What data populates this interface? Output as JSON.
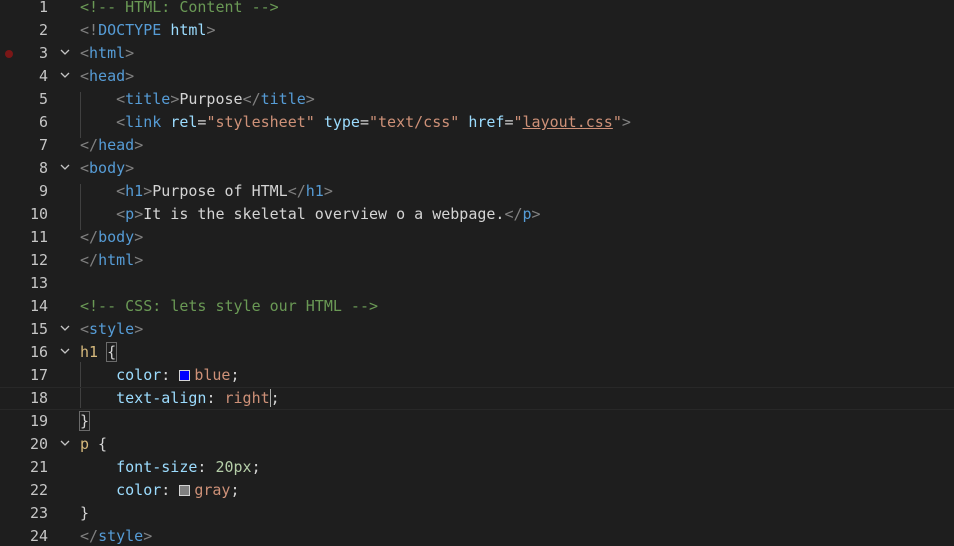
{
  "editor": {
    "breakpoint_line": 3,
    "colors": {
      "background": "#1e1e1e",
      "comment": "#6a9955",
      "tag": "#569cd6",
      "attribute": "#9cdcfe",
      "string": "#ce9178",
      "selector": "#d7ba7d",
      "number": "#b5cea8",
      "breakpoint": "#7a1717"
    },
    "swatches": {
      "blue": "#0000ff",
      "gray": "#808080"
    },
    "lines": [
      {
        "n": "1",
        "tokens": [
          [
            "c-comment",
            "<!-- HTML: Content -->"
          ]
        ]
      },
      {
        "n": "2",
        "tokens": [
          [
            "c-punct",
            "<!"
          ],
          [
            "c-tag",
            "DOCTYPE"
          ],
          [
            "c-text",
            " "
          ],
          [
            "c-attr",
            "html"
          ],
          [
            "c-punct",
            ">"
          ]
        ]
      },
      {
        "n": "3",
        "fold": true,
        "tokens": [
          [
            "c-punct",
            "<"
          ],
          [
            "c-tag",
            "html"
          ],
          [
            "c-punct",
            ">"
          ]
        ]
      },
      {
        "n": "4",
        "fold": true,
        "tokens": [
          [
            "c-punct",
            "<"
          ],
          [
            "c-tag",
            "head"
          ],
          [
            "c-punct",
            ">"
          ]
        ]
      },
      {
        "n": "5",
        "tokens": [
          [
            "c-text",
            "    "
          ],
          [
            "c-punct",
            "<"
          ],
          [
            "c-tag",
            "title"
          ],
          [
            "c-punct",
            ">"
          ],
          [
            "c-text",
            "Purpose"
          ],
          [
            "c-punct",
            "</"
          ],
          [
            "c-tag",
            "title"
          ],
          [
            "c-punct",
            ">"
          ]
        ]
      },
      {
        "n": "6",
        "tokens": [
          [
            "c-text",
            "    "
          ],
          [
            "c-punct",
            "<"
          ],
          [
            "c-tag",
            "link"
          ],
          [
            "c-text",
            " "
          ],
          [
            "c-attr",
            "rel"
          ],
          [
            "c-text",
            "="
          ],
          [
            "c-str",
            "\"stylesheet\""
          ],
          [
            "c-text",
            " "
          ],
          [
            "c-attr",
            "type"
          ],
          [
            "c-text",
            "="
          ],
          [
            "c-str",
            "\"text/css\""
          ],
          [
            "c-text",
            " "
          ],
          [
            "c-attr",
            "href"
          ],
          [
            "c-text",
            "="
          ],
          [
            "c-str",
            "\""
          ],
          [
            "c-str link-under",
            "layout.css"
          ],
          [
            "c-str",
            "\""
          ],
          [
            "c-punct",
            ">"
          ]
        ]
      },
      {
        "n": "7",
        "tokens": [
          [
            "c-punct",
            "</"
          ],
          [
            "c-tag",
            "head"
          ],
          [
            "c-punct",
            ">"
          ]
        ]
      },
      {
        "n": "8",
        "fold": true,
        "tokens": [
          [
            "c-punct",
            "<"
          ],
          [
            "c-tag",
            "body"
          ],
          [
            "c-punct",
            ">"
          ]
        ]
      },
      {
        "n": "9",
        "tokens": [
          [
            "c-text",
            "    "
          ],
          [
            "c-punct",
            "<"
          ],
          [
            "c-tag",
            "h1"
          ],
          [
            "c-punct",
            ">"
          ],
          [
            "c-text",
            "Purpose of HTML"
          ],
          [
            "c-punct",
            "</"
          ],
          [
            "c-tag",
            "h1"
          ],
          [
            "c-punct",
            ">"
          ]
        ]
      },
      {
        "n": "10",
        "tokens": [
          [
            "c-text",
            "    "
          ],
          [
            "c-punct",
            "<"
          ],
          [
            "c-tag",
            "p"
          ],
          [
            "c-punct",
            ">"
          ],
          [
            "c-text",
            "It is the skeletal overview o a webpage."
          ],
          [
            "c-punct",
            "</"
          ],
          [
            "c-tag",
            "p"
          ],
          [
            "c-punct",
            ">"
          ]
        ]
      },
      {
        "n": "11",
        "tokens": [
          [
            "c-punct",
            "</"
          ],
          [
            "c-tag",
            "body"
          ],
          [
            "c-punct",
            ">"
          ]
        ]
      },
      {
        "n": "12",
        "tokens": [
          [
            "c-punct",
            "</"
          ],
          [
            "c-tag",
            "html"
          ],
          [
            "c-punct",
            ">"
          ]
        ]
      },
      {
        "n": "13",
        "tokens": []
      },
      {
        "n": "14",
        "tokens": [
          [
            "c-comment",
            "<!-- CSS: lets style our HTML -->"
          ]
        ]
      },
      {
        "n": "15",
        "fold": true,
        "tokens": [
          [
            "c-punct",
            "<"
          ],
          [
            "c-tag",
            "style"
          ],
          [
            "c-punct",
            ">"
          ]
        ]
      },
      {
        "n": "16",
        "fold": true,
        "tokens": [
          [
            "c-sel",
            "h1"
          ],
          [
            "c-text",
            " "
          ],
          [
            "c-text bracket-hl",
            "{"
          ]
        ]
      },
      {
        "n": "17",
        "tokens": [
          [
            "c-text",
            "    "
          ],
          [
            "c-attr",
            "color"
          ],
          [
            "c-text",
            ": "
          ],
          [
            "swatch",
            "blue"
          ],
          [
            "c-str",
            "blue"
          ],
          [
            "c-text",
            ";"
          ]
        ]
      },
      {
        "n": "18",
        "current": true,
        "tokens": [
          [
            "c-text",
            "    "
          ],
          [
            "c-attr",
            "text-align"
          ],
          [
            "c-text",
            ": "
          ],
          [
            "c-str",
            "right"
          ],
          [
            "cursor",
            ""
          ],
          [
            "c-text",
            ";"
          ]
        ]
      },
      {
        "n": "19",
        "tokens": [
          [
            "c-text bracket-hl",
            "}"
          ]
        ]
      },
      {
        "n": "20",
        "fold": true,
        "tokens": [
          [
            "c-sel",
            "p"
          ],
          [
            "c-text",
            " {"
          ]
        ]
      },
      {
        "n": "21",
        "tokens": [
          [
            "c-text",
            "    "
          ],
          [
            "c-attr",
            "font-size"
          ],
          [
            "c-text",
            ": "
          ],
          [
            "c-num",
            "20px"
          ],
          [
            "c-text",
            ";"
          ]
        ]
      },
      {
        "n": "22",
        "tokens": [
          [
            "c-text",
            "    "
          ],
          [
            "c-attr",
            "color"
          ],
          [
            "c-text",
            ": "
          ],
          [
            "swatch",
            "gray"
          ],
          [
            "c-str",
            "gray"
          ],
          [
            "c-text",
            ";"
          ]
        ]
      },
      {
        "n": "23",
        "tokens": [
          [
            "c-text",
            "}"
          ]
        ]
      },
      {
        "n": "24",
        "tokens": [
          [
            "c-punct",
            "</"
          ],
          [
            "c-tag",
            "style"
          ],
          [
            "c-punct",
            ">"
          ]
        ]
      }
    ]
  }
}
